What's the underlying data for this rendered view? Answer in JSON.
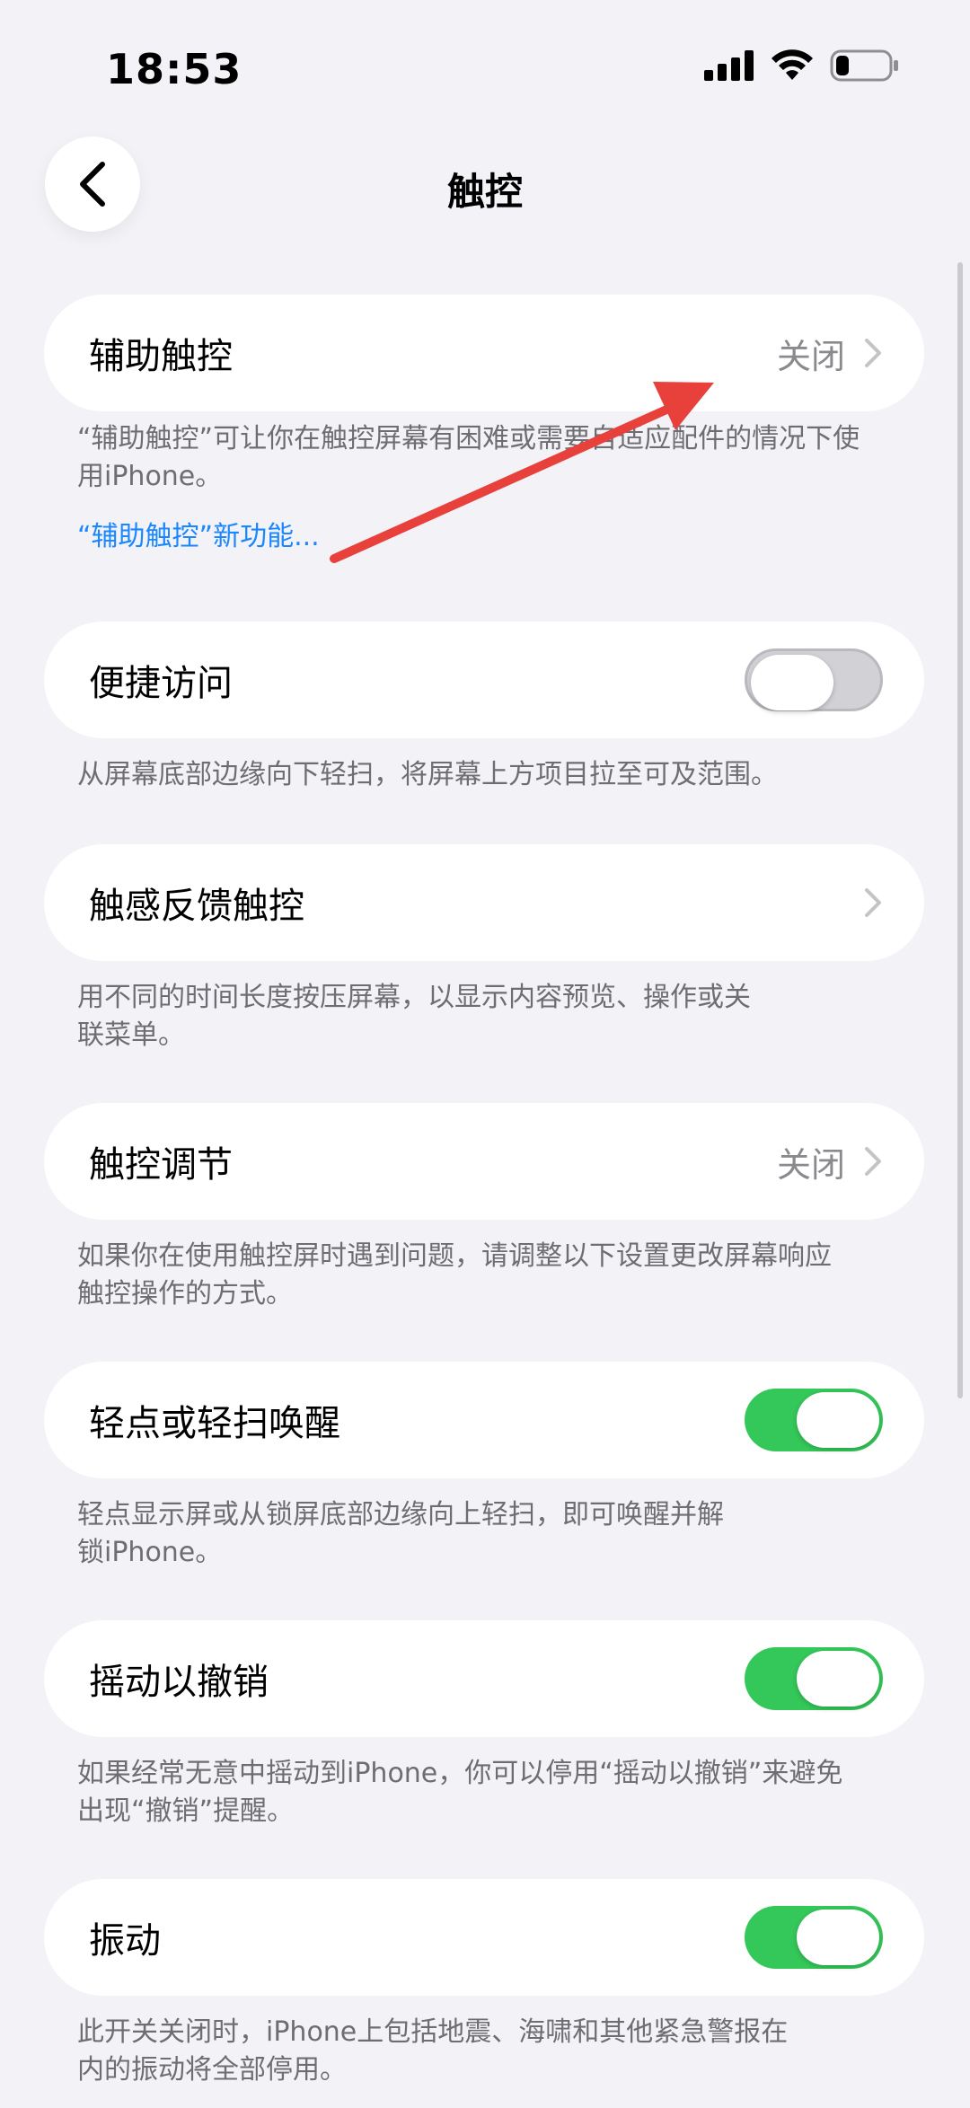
{
  "status_bar": {
    "time": "18:53",
    "icons": [
      "cellular-signal-icon",
      "wifi-icon",
      "battery-icon"
    ],
    "battery_level": 0.2
  },
  "nav": {
    "title": "触控",
    "back_icon": "chevron-left-icon"
  },
  "sections": {
    "assistive_touch": {
      "label": "辅助触控",
      "value": "关闭",
      "footer": "“辅助触控”可让你在触控屏幕有困难或需要自适应配件的情况下使用iPhone。",
      "link": "“辅助触控”新功能..."
    },
    "reachability": {
      "label": "便捷访问",
      "toggle_on": false,
      "footer": "从屏幕底部边缘向下轻扫，将屏幕上方项目拉至可及范围。"
    },
    "haptic_touch": {
      "label": "触感反馈触控",
      "footer": "用不同的时间长度按压屏幕，以显示内容预览、操作或关联菜单。"
    },
    "touch_accommodations": {
      "label": "触控调节",
      "value": "关闭",
      "footer": "如果你在使用触控屏时遇到问题，请调整以下设置更改屏幕响应触控操作的方式。"
    },
    "tap_to_wake": {
      "label": "轻点或轻扫唤醒",
      "toggle_on": true,
      "footer": "轻点显示屏或从锁屏底部边缘向上轻扫，即可唤醒并解锁iPhone。"
    },
    "shake_to_undo": {
      "label": "摇动以撤销",
      "toggle_on": true,
      "footer": "如果经常无意中摇动到iPhone，你可以停用“摇动以撤销”来避免出现“撤销”提醒。"
    },
    "vibration": {
      "label": "振动",
      "toggle_on": true,
      "footer": "此开关关闭时，iPhone上包括地震、海啸和其他紧急警报在内的振动将全部停用。"
    }
  },
  "colors": {
    "background": "#f2f2f7",
    "toggle_on": "#34c759",
    "link": "#1a87ff",
    "annotation_arrow": "#e8413c"
  }
}
